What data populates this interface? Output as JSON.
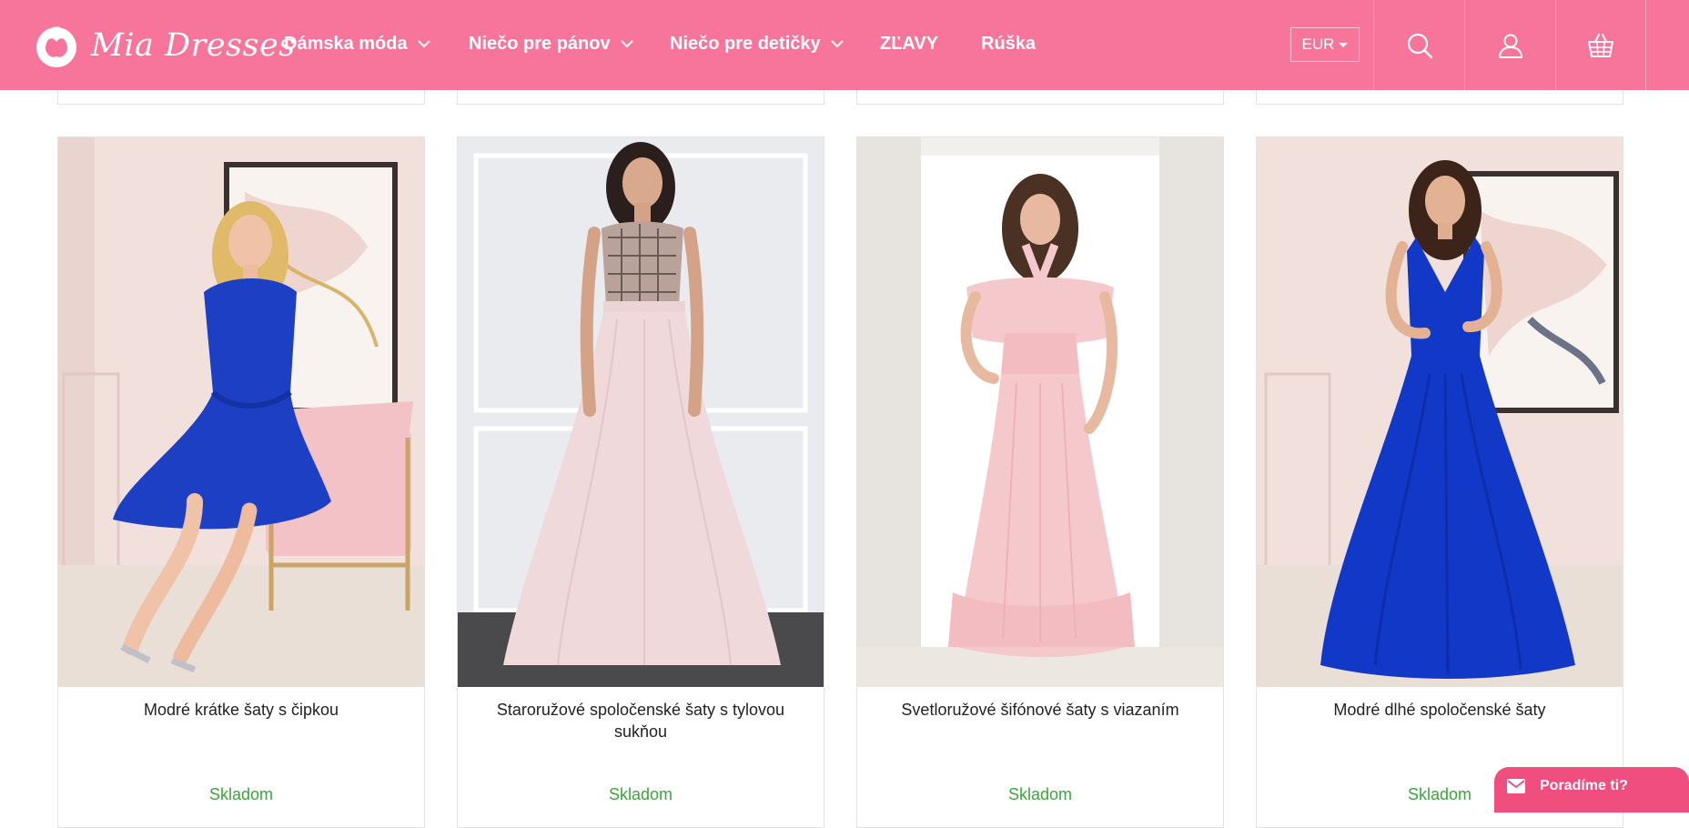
{
  "brand": {
    "name": "Mia Dresses",
    "header_color": "#f7759a",
    "accent_color": "#ef4e7e",
    "stock_color": "#3aa63a"
  },
  "nav": {
    "items": [
      {
        "label": "Dámska móda",
        "has_dropdown": true
      },
      {
        "label": "Niečo pre pánov",
        "has_dropdown": true
      },
      {
        "label": "Niečo pre detičky",
        "has_dropdown": true
      },
      {
        "label": "ZĽAVY",
        "has_dropdown": false
      },
      {
        "label": "Rúška",
        "has_dropdown": false
      }
    ]
  },
  "header": {
    "currency": "EUR",
    "icons": [
      "search-icon",
      "user-icon",
      "basket-icon"
    ]
  },
  "products": [
    {
      "title": "Modré krátke šaty s čipkou",
      "stock": "Skladom",
      "dress_color": "#1d3fc4"
    },
    {
      "title": "Staroružové spoločenské šaty s tylovou sukňou",
      "stock": "Skladom",
      "dress_color": "#f0d9db"
    },
    {
      "title": "Svetloružové šifónové šaty s viazaním",
      "stock": "Skladom",
      "dress_color": "#f5c8cc"
    },
    {
      "title": "Modré dlhé spoločenské šaty",
      "stock": "Skladom",
      "dress_color": "#1238c8"
    }
  ],
  "chat": {
    "label": "Poradíme ti?"
  }
}
